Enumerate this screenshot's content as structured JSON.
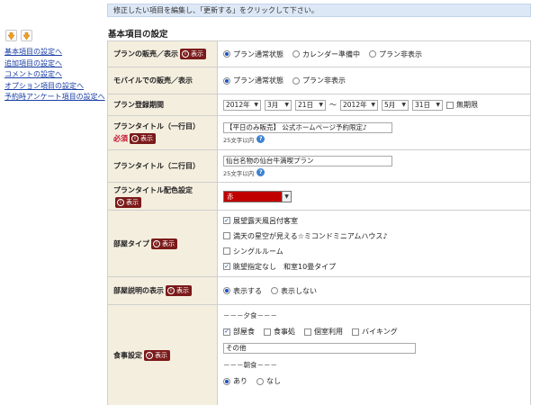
{
  "notice": "修正したい項目を編集し、「更新する」をクリックして下さい。",
  "section_title": "基本項目の設定",
  "sidebar": {
    "links": [
      "基本項目の設定へ",
      "追加項目の設定へ",
      "コメントの設定へ",
      "オプション項目の設定へ",
      "予約時アンケート項目の設定へ"
    ]
  },
  "badge_label": "表示",
  "badge_icon": "i",
  "rows": {
    "sale": {
      "label": "プランの販売／表示",
      "options": [
        "プラン通常状態",
        "カレンダー準備中",
        "プラン非表示"
      ]
    },
    "mobile": {
      "label": "モバイルでの販売／表示",
      "options": [
        "プラン通常状態",
        "プラン非表示"
      ]
    },
    "period": {
      "label": "プラン登録期間",
      "start_year": "2012年",
      "start_month": "3月",
      "start_day": "21日",
      "sep": "～",
      "end_year": "2012年",
      "end_month": "5月",
      "end_day": "31日",
      "unlimited": "無期限"
    },
    "title1": {
      "label": "プランタイトル（一行目）",
      "required": "必須",
      "value": "【平日のみ販売】 公式ホームページ予約限定♪",
      "hint": "25文字以内"
    },
    "title2": {
      "label": "プランタイトル（二行目）",
      "value": "仙台名物の仙台牛満喫プラン",
      "hint": "25文字以内"
    },
    "title_color": {
      "label": "プランタイトル配色設定",
      "value": "赤"
    },
    "room": {
      "label": "部屋タイプ",
      "items": [
        "展望露天風呂付客室",
        "満天の星空が見える☆ミコンドミニアムハウス♪",
        "シングルルーム",
        "眺望指定なし　和室10畳タイプ"
      ]
    },
    "room_desc": {
      "label": "部屋説明の表示",
      "options": [
        "表示する",
        "表示しない"
      ]
    },
    "meal": {
      "label": "食事設定",
      "dinner_head": "－－－夕食－－－",
      "dinner_options": [
        "部屋食",
        "食事処",
        "個室利用",
        "バイキング"
      ],
      "other_label": "その他",
      "breakfast_head": "－－－朝食－－－",
      "breakfast_options": [
        "あり",
        "なし"
      ]
    }
  },
  "help_icon": "?",
  "colors": {
    "accent": "#7b1a1a",
    "notice_bg": "#dde8f6",
    "label_bg": "#f4eedf",
    "title_color_value": "#c00000",
    "link": "#1a3fa5",
    "radio": "#1d4fc4"
  }
}
